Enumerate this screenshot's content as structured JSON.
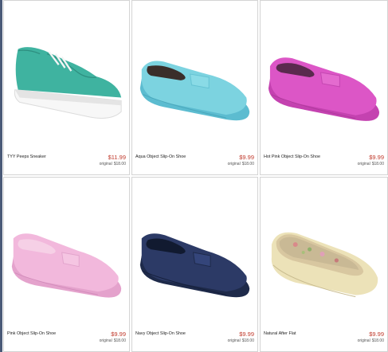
{
  "products": [
    {
      "name": "TYY Peeps Sneaker",
      "price": "$11.99",
      "original_label": "original",
      "original_price": "$18.00",
      "color": "#3fb3a0"
    },
    {
      "name": "Aqua Object Slip-On Shoe",
      "price": "$9.99",
      "original_label": "original",
      "original_price": "$18.00",
      "color": "#7cd3e0"
    },
    {
      "name": "Hot Pink Object Slip-On Shoe",
      "price": "$9.99",
      "original_label": "original",
      "original_price": "$18.00",
      "color": "#dc56c6"
    },
    {
      "name": "Pink Object Slip-On Shoe",
      "price": "$9.99",
      "original_label": "original",
      "original_price": "$18.00",
      "color": "#f2b8dc"
    },
    {
      "name": "Navy Object Slip-On Shoe",
      "price": "$9.99",
      "original_label": "original",
      "original_price": "$18.00",
      "color": "#2c3a66"
    },
    {
      "name": "Natural After Flat",
      "price": "$9.99",
      "original_label": "original",
      "original_price": "$18.00",
      "color": "#ece2b8"
    }
  ]
}
